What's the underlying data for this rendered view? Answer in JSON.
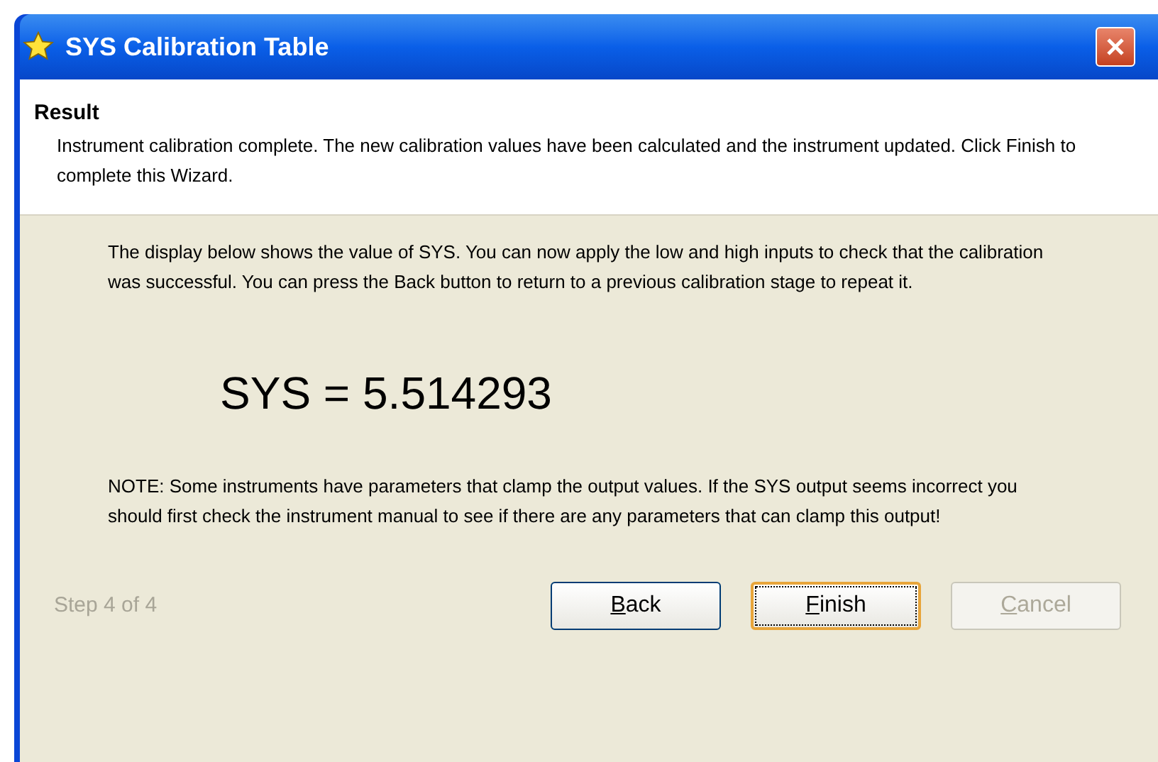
{
  "window": {
    "title": "SYS Calibration Table"
  },
  "header": {
    "title": "Result",
    "description": "Instrument calibration complete. The new calibration values have been calculated and the instrument updated. Click Finish to complete this Wizard."
  },
  "body": {
    "intro": "The display below shows the value of SYS. You can now apply the low and high inputs to check that the calibration was successful. You can press the Back button to return to a previous calibration stage to repeat it.",
    "reading": "SYS = 5.514293",
    "note": "NOTE: Some instruments have parameters that clamp the output values. If the SYS output seems incorrect you should first check the instrument manual to see if there are any parameters that can clamp this output!"
  },
  "footer": {
    "step": "Step 4 of 4",
    "buttons": [
      {
        "label": "Back",
        "default": false,
        "disabled": false
      },
      {
        "label": "Finish",
        "default": true,
        "disabled": false
      },
      {
        "label": "Cancel",
        "default": false,
        "disabled": true
      }
    ]
  }
}
